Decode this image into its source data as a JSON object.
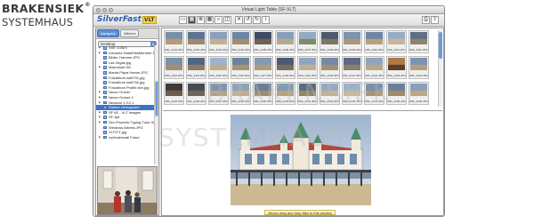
{
  "brand": {
    "line1": "BRAKENSIEK",
    "registered": "®",
    "line2": "SYSTEMHAUS"
  },
  "watermark": {
    "line1": "BRAKENSIEK",
    "line2": "SYSTEMHAUS"
  },
  "window": {
    "title": "Virtual Light Table (SF-VLT)"
  },
  "app": {
    "logo_main": "SilverFast",
    "logo_vlt": "VLT"
  },
  "left_pane": {
    "tabs": [
      "Navigator",
      "Albums"
    ],
    "folder_select": "Desktop",
    "tree": [
      {
        "label": "SSE 1GB/X",
        "indent": 0,
        "expander": "▶",
        "selected": false
      },
      {
        "label": "Volumes Data/DiskMember 1",
        "indent": 0,
        "expander": "▶",
        "selected": false
      },
      {
        "label": "Bilder, Hamme.JPG",
        "indent": 0,
        "expander": "",
        "selected": false
      },
      {
        "label": "Las Vegas.jpg",
        "indent": 0,
        "expander": "",
        "selected": false
      },
      {
        "label": "Macintosh HD",
        "indent": 0,
        "expander": "▶",
        "selected": false
      },
      {
        "label": "Manta Plaza Hamm.JPG",
        "indent": 0,
        "expander": "",
        "selected": false
      },
      {
        "label": "Fotoalbum sst6701.jpg",
        "indent": 0,
        "expander": "",
        "selected": false
      },
      {
        "label": "Fotoalbum sst6702.jpg",
        "indent": 0,
        "expander": "",
        "selected": false
      },
      {
        "label": "Fotoalbum Profile.stm.jpg",
        "indent": 0,
        "expander": "",
        "selected": false
      },
      {
        "label": "Neuer Ordner",
        "indent": 0,
        "expander": "▶",
        "selected": false
      },
      {
        "label": "Neuer Ordner 2",
        "indent": 0,
        "expander": "▶",
        "selected": false
      },
      {
        "label": "Neuland 1.3.0.1",
        "indent": 0,
        "expander": "▶",
        "selected": false
      },
      {
        "label": "Ostsee Heringsdorf",
        "indent": 0,
        "expander": "▼",
        "selected": true
      },
      {
        "label": "SF 6E - VLT Images",
        "indent": 0,
        "expander": "▶",
        "selected": false
      },
      {
        "label": "SF-Apt",
        "indent": 0,
        "expander": "▶",
        "selected": false
      },
      {
        "label": "Sev Phonetic Typing Tutor III",
        "indent": 0,
        "expander": "▶",
        "selected": false
      },
      {
        "label": "Windows Arbeits.JPG",
        "indent": 0,
        "expander": "",
        "selected": false
      },
      {
        "label": "VLT971.jpg",
        "indent": 0,
        "expander": "",
        "selected": false
      },
      {
        "label": "vorlindenwall Fotod",
        "indent": 0,
        "expander": "▶",
        "selected": false
      }
    ]
  },
  "thumbnails": [
    {
      "label": "IMG_4101.JPG",
      "color_top": "#7a8fa8",
      "color_bottom": "#b59a74"
    },
    {
      "label": "IMG_4102.JPG",
      "color_top": "#5d7391",
      "color_bottom": "#9b8a6e"
    },
    {
      "label": "IMG_4103.JPG",
      "color_top": "#8aa0bb",
      "color_bottom": "#c4b092"
    },
    {
      "label": "IMG_4104.JPG",
      "color_top": "#6b86a6",
      "color_bottom": "#a38e6f"
    },
    {
      "label": "IMG_4105.JPG",
      "color_top": "#3d4c63",
      "color_bottom": "#6b6253"
    },
    {
      "label": "IMG_4106.JPG",
      "color_top": "#889fb9",
      "color_bottom": "#b8a88a"
    },
    {
      "label": "IMG_4107.JPG",
      "color_top": "#95aac4",
      "color_bottom": "#7d8b6a"
    },
    {
      "label": "IMG_4108.JPG",
      "color_top": "#4b5a6e",
      "color_bottom": "#7d7565"
    },
    {
      "label": "IMG_4109.JPG",
      "color_top": "#7e93ad",
      "color_bottom": "#a99776"
    },
    {
      "label": "IMG_4110.JPG",
      "color_top": "#6f86a3",
      "color_bottom": "#b7a17c"
    },
    {
      "label": "IMG_4111.JPG",
      "color_top": "#98adc5",
      "color_bottom": "#c7b599"
    },
    {
      "label": "IMG_4112.JPG",
      "color_top": "#5f6f84",
      "color_bottom": "#8e836d"
    },
    {
      "label": "IMG_4113.JPG",
      "color_top": "#7b90aa",
      "color_bottom": "#a38f70"
    },
    {
      "label": "IMG_4114.JPG",
      "color_top": "#506784",
      "color_bottom": "#8d7c61"
    },
    {
      "label": "IMG_4115.JPG",
      "color_top": "#9fb4cc",
      "color_bottom": "#c0ab8a"
    },
    {
      "label": "IMG_4116.JPG",
      "color_top": "#6c829f",
      "color_bottom": "#a8936f"
    },
    {
      "label": "IMG_4117.JPG",
      "color_top": "#8499b3",
      "color_bottom": "#b09c7d"
    },
    {
      "label": "IMG_4118.JPG",
      "color_top": "#4a5a71",
      "color_bottom": "#7a6e5b"
    },
    {
      "label": "IMG_4119.JPG",
      "color_top": "#90a6c0",
      "color_bottom": "#c2ae8e"
    },
    {
      "label": "IMG_4120.JPG",
      "color_top": "#7389a6",
      "color_bottom": "#a59070"
    },
    {
      "label": "IMG_4121.JPG",
      "color_top": "#5a6c84",
      "color_bottom": "#8c7f67"
    },
    {
      "label": "IMG_4122.JPG",
      "color_top": "#8ea3bd",
      "color_bottom": "#bba685"
    },
    {
      "label": "IMG_4123.JPG",
      "color_top": "#b07a45",
      "color_bottom": "#5d3f25"
    },
    {
      "label": "IMG_4124.JPG",
      "color_top": "#7d93ae",
      "color_bottom": "#b39f7f"
    },
    {
      "label": "IMG_4125.JPG",
      "color_top": "#3f3a36",
      "color_bottom": "#6b5c4c"
    },
    {
      "label": "IMG_4126.JPG",
      "color_top": "#464c56",
      "color_bottom": "#6f6659"
    },
    {
      "label": "IMG_4127.JPG",
      "color_top": "#7d93b0",
      "color_bottom": "#b3a083"
    },
    {
      "label": "IMG_4128.JPG",
      "color_top": "#8da2bb",
      "color_bottom": "#c1ad8f"
    },
    {
      "label": "IMG_4129.JPG",
      "color_top": "#6b7e97",
      "color_bottom": "#9e8c70"
    },
    {
      "label": "IMG_4130.JPG",
      "color_top": "#819ab6",
      "color_bottom": "#b6a180"
    },
    {
      "label": "IMG_4131.JPG",
      "color_top": "#5a6a82",
      "color_bottom": "#938568"
    },
    {
      "label": "IMG_4132.JPG",
      "color_top": "#94aac3",
      "color_bottom": "#c4b092"
    },
    {
      "label": "IMG_4133.JPG",
      "color_top": "#9bb0c8",
      "color_bottom": "#c9b79a"
    },
    {
      "label": "IMG_4134.JPG",
      "color_top": "#7990ab",
      "color_bottom": "#a99472"
    },
    {
      "label": "IMG_4135.JPG",
      "color_top": "#6a7f9b",
      "color_bottom": "#9f8b6b"
    },
    {
      "label": "IMG_4136.JPG",
      "color_top": "#89a0ba",
      "color_bottom": "#bba787"
    }
  ],
  "viewer": {
    "status_text": "Album-drag and drop files to this window"
  }
}
